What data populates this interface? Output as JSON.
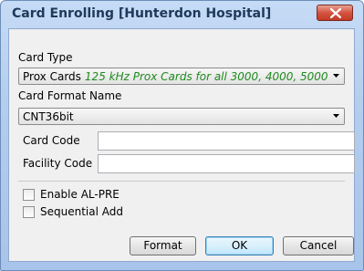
{
  "window": {
    "title": "Card Enrolling [Hunterdon Hospital]",
    "close_icon": "close-x-icon"
  },
  "form": {
    "card_type_label": "Card Type",
    "card_type_value": "Prox Cards",
    "card_type_description": "125 kHz Prox Cards for all 3000, 4000, 5000",
    "card_format_label": "Card Format Name",
    "card_format_value": "CNT36bit",
    "card_code_label": "Card Code",
    "card_code_value": "",
    "facility_code_label": "Facility Code",
    "facility_code_value": "",
    "enable_al_pre_label": "Enable AL-PRE",
    "enable_al_pre_checked": false,
    "sequential_add_label": "Sequential Add",
    "sequential_add_checked": false
  },
  "buttons": {
    "format": "Format",
    "ok": "OK",
    "cancel": "Cancel"
  },
  "colors": {
    "description_text": "#1e8a1e",
    "close_button": "#c23a24",
    "title_text": "#1e395b"
  }
}
